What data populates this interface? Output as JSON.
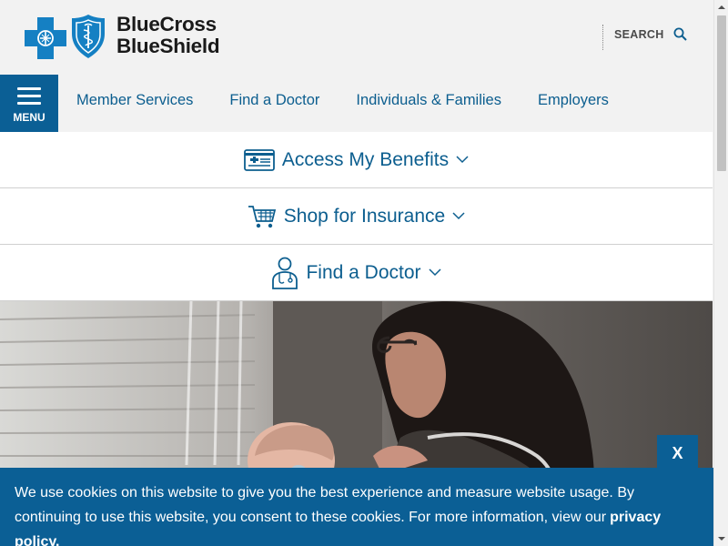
{
  "brand": {
    "line1": "BlueCross",
    "line2": "BlueShield",
    "blue": "#0b5f95",
    "link_blue": "#0c5e8f"
  },
  "header": {
    "search_label": "SEARCH",
    "search_icon": "search-icon"
  },
  "nav": {
    "menu_label": "MENU",
    "links": [
      "Member Services",
      "Find a Doctor",
      "Individuals & Families",
      "Employers"
    ]
  },
  "accordion": [
    {
      "label": "Access My Benefits",
      "icon": "member-card-icon"
    },
    {
      "label": "Shop for Insurance",
      "icon": "shopping-cart-icon"
    },
    {
      "label": "Find a Doctor",
      "icon": "doctor-icon"
    }
  ],
  "cookie": {
    "text": "We use cookies on this website to give you the best experience and measure website usage. By continuing to use this website, you consent to these cookies. For more information, view our",
    "link_text": "privacy policy.",
    "close_label": "X"
  }
}
